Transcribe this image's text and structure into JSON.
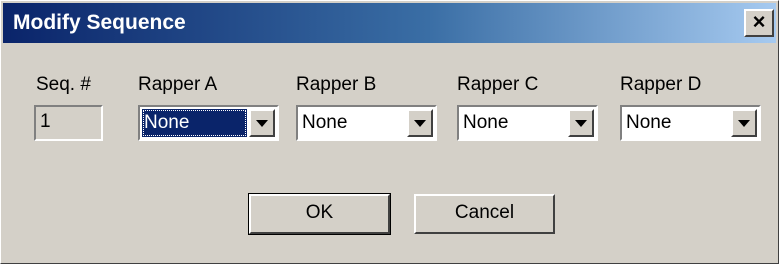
{
  "window": {
    "title": "Modify Sequence",
    "close_glyph": "×"
  },
  "fields": {
    "seq_label": "Seq. #",
    "seq_value": "1",
    "rappers": [
      {
        "label": "Rapper A",
        "value": "None"
      },
      {
        "label": "Rapper B",
        "value": "None"
      },
      {
        "label": "Rapper C",
        "value": "None"
      },
      {
        "label": "Rapper D",
        "value": "None"
      }
    ]
  },
  "buttons": {
    "ok": "OK",
    "cancel": "Cancel"
  },
  "colors": {
    "titlebar_start": "#0a246a",
    "titlebar_end": "#a6caf0",
    "face": "#d4d0c8",
    "selection": "#0a246a"
  },
  "icons": {
    "close": "close-icon",
    "dropdown": "chevron-down-icon"
  }
}
